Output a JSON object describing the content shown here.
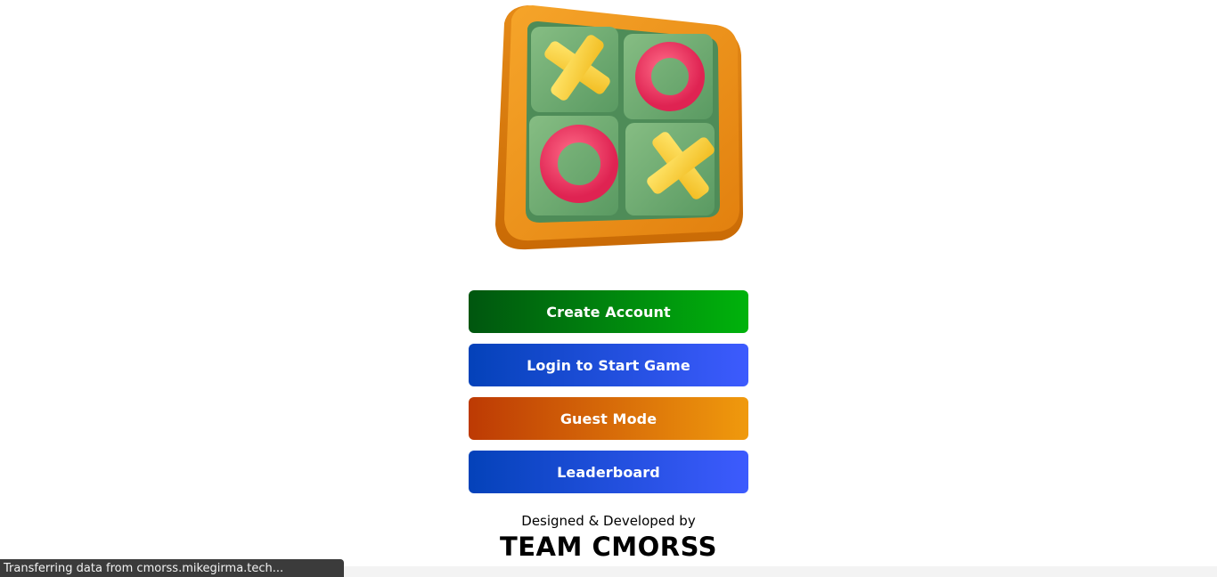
{
  "logo": {
    "icon": "tic-tac-toe-board-icon",
    "colors": {
      "frame": "#f0951a",
      "board": "#6aa86f",
      "x_piece": "#f7d23a",
      "o_piece": "#ee3f66"
    }
  },
  "menu": {
    "create_account": "Create Account",
    "login": "Login to Start Game",
    "guest": "Guest Mode",
    "leaderboard": "Leaderboard"
  },
  "footer": {
    "credit": "Designed & Developed by",
    "team": "TEAM CMORSS"
  },
  "status_bar": {
    "text": "Transferring data from cmorss.mikegirma.tech..."
  },
  "colors": {
    "create_start": "#00560f",
    "create_end": "#00b30c",
    "login_start": "#0442b9",
    "login_end": "#3d5bfe",
    "guest_start": "#bd3a04",
    "guest_end": "#f09a0d"
  }
}
